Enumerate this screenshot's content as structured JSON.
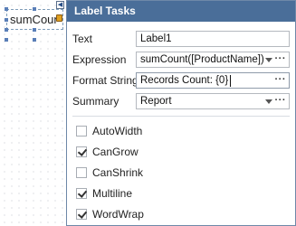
{
  "designer": {
    "control_text": "sumCount"
  },
  "panel": {
    "title": "Label Tasks",
    "rows": {
      "text": {
        "label": "Text",
        "value": "Label1"
      },
      "expression": {
        "label": "Expression",
        "value": "sumCount([ProductName])"
      },
      "format_string": {
        "label": "Format String",
        "value": "Records Count: {0}"
      },
      "summary": {
        "label": "Summary",
        "value": "Report"
      }
    },
    "ellipsis": "···",
    "checks": {
      "autowidth": {
        "label": "AutoWidth",
        "checked": false
      },
      "cangrow": {
        "label": "CanGrow",
        "checked": true
      },
      "canshrink": {
        "label": "CanShrink",
        "checked": false
      },
      "multiline": {
        "label": "Multiline",
        "checked": true
      },
      "wordwrap": {
        "label": "WordWrap",
        "checked": true
      }
    }
  },
  "colors": {
    "header_bg": "#4a6e99",
    "handle": "#5a7fb8"
  },
  "icons": {
    "smart_tag": "chevron-left-icon",
    "label_glyph": "summary-tag-icon"
  }
}
